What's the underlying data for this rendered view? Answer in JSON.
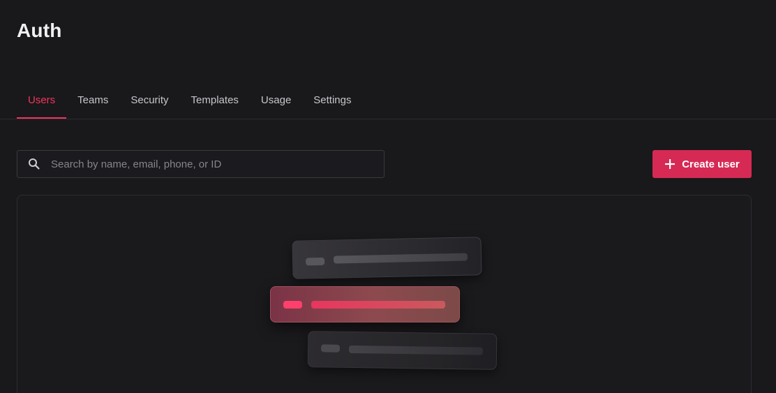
{
  "app": {
    "title": "Auth"
  },
  "tabs": [
    {
      "label": "Users",
      "active": true
    },
    {
      "label": "Teams",
      "active": false
    },
    {
      "label": "Security",
      "active": false
    },
    {
      "label": "Templates",
      "active": false
    },
    {
      "label": "Usage",
      "active": false
    },
    {
      "label": "Settings",
      "active": false
    }
  ],
  "search": {
    "placeholder": "Search by name, email, phone, or ID",
    "value": "",
    "icon": "search-icon"
  },
  "create_user": {
    "label": "Create user",
    "icon": "plus-icon"
  },
  "colors": {
    "accent": "#f0365d",
    "button": "#d62a55",
    "background": "#19181b"
  }
}
